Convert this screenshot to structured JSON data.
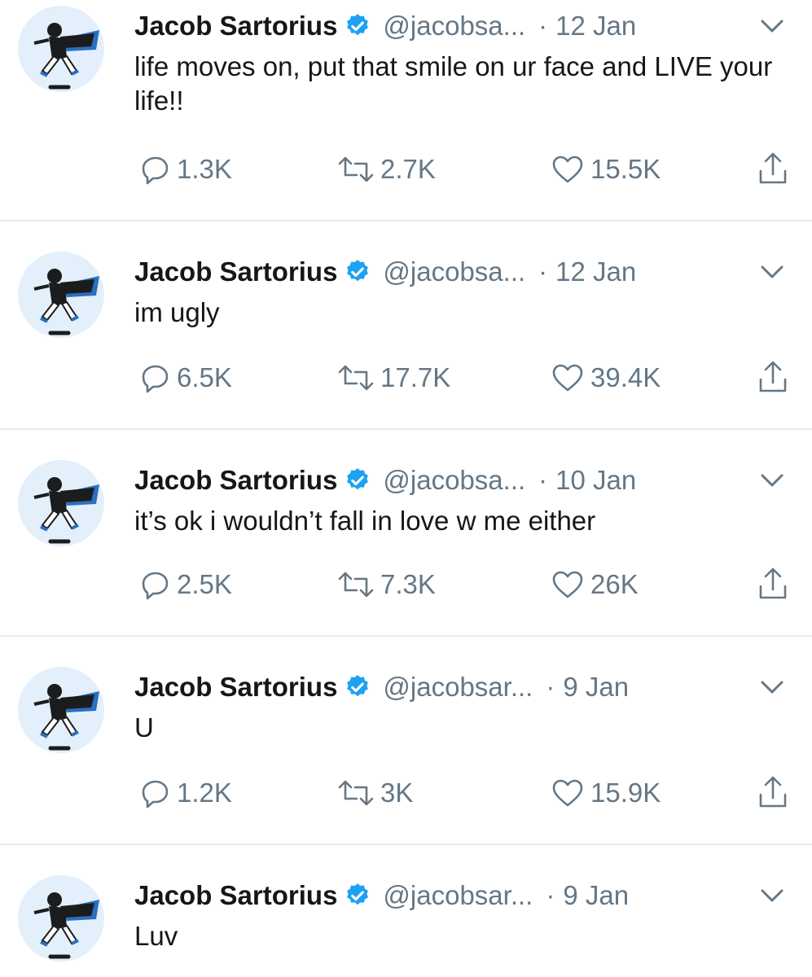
{
  "tweets": [
    {
      "name": "Jacob Sartorius",
      "handle": "@jacobsa...",
      "date": "12 Jan",
      "text": "life moves on, put that smile on ur face and LIVE your life!!",
      "replies": "1.3K",
      "retweets": "2.7K",
      "likes": "15.5K"
    },
    {
      "name": "Jacob Sartorius",
      "handle": "@jacobsa...",
      "date": "12 Jan",
      "text": "im ugly",
      "replies": "6.5K",
      "retweets": "17.7K",
      "likes": "39.4K"
    },
    {
      "name": "Jacob Sartorius",
      "handle": "@jacobsa...",
      "date": "10 Jan",
      "text": "it’s ok i wouldn’t fall in love w me either",
      "replies": "2.5K",
      "retweets": "7.3K",
      "likes": "26K"
    },
    {
      "name": "Jacob Sartorius",
      "handle": "@jacobsar...",
      "date": "9 Jan",
      "text": "U",
      "replies": "1.2K",
      "retweets": "3K",
      "likes": "15.9K"
    },
    {
      "name": "Jacob Sartorius",
      "handle": "@jacobsar...",
      "date": "9 Jan",
      "text": "Luv",
      "replies": "",
      "retweets": "",
      "likes": ""
    }
  ],
  "header_separator": "·",
  "colors": {
    "verified": "#1da1f2",
    "secondary_text": "#657786",
    "divider": "#e6ecf0"
  },
  "icons": [
    "verified-badge-icon",
    "chevron-down-icon",
    "reply-icon",
    "retweet-icon",
    "like-icon",
    "share-icon"
  ]
}
